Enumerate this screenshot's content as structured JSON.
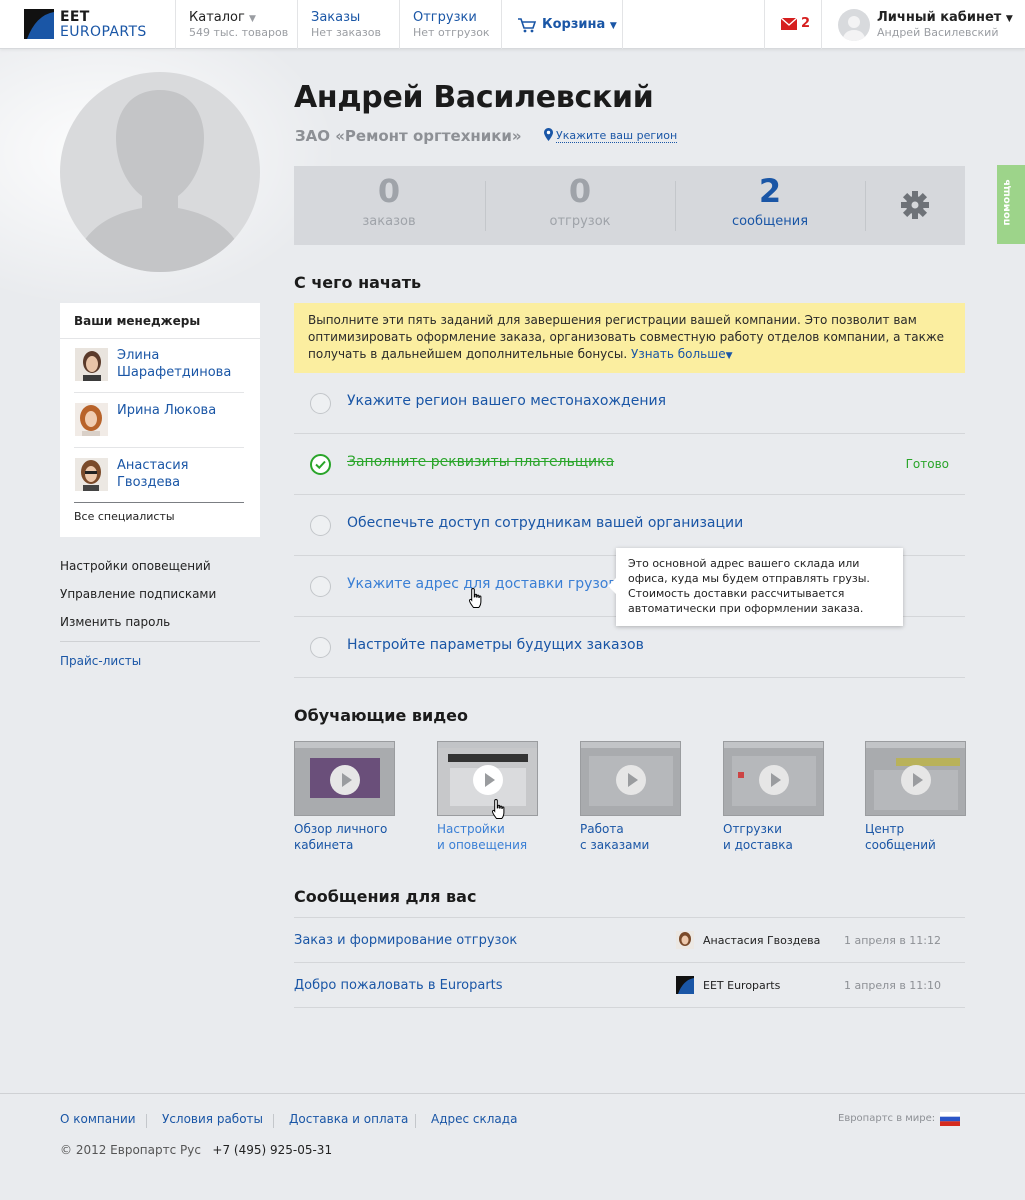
{
  "header": {
    "logo_top": "EET",
    "logo_bottom": "EUROPARTS",
    "nav": [
      {
        "label": "Каталог",
        "sub": "549 тыс. товаров"
      },
      {
        "label": "Заказы",
        "sub": "Нет заказов"
      },
      {
        "label": "Отгрузки",
        "sub": "Нет отгрузок"
      }
    ],
    "cart_label": "Корзина",
    "mail_count": "2",
    "account_label": "Личный кабинет",
    "account_user": "Андрей Василевский"
  },
  "profile": {
    "name": "Андрей Василевский",
    "company": "ЗАО «Ремонт оргтехники»",
    "region_link": "Укажите ваш регион"
  },
  "stats": [
    {
      "value": "0",
      "caption": "заказов"
    },
    {
      "value": "0",
      "caption": "отгрузок"
    },
    {
      "value": "2",
      "caption": "сообщения"
    }
  ],
  "help_label": "помощь",
  "managers": {
    "title": "Ваши менеджеры",
    "items": [
      {
        "name": "Элина Шарафетдинова"
      },
      {
        "name": "Ирина Люкова"
      },
      {
        "name": "Анастасия Гвоздева"
      }
    ],
    "all_link": "Все специалисты"
  },
  "left_menu": [
    "Настройки оповещений",
    "Управление подписками",
    "Изменить пароль"
  ],
  "price_lists": "Прайс-листы",
  "start": {
    "title": "С чего начать",
    "note": "Выполните эти пять заданий для завершения регистрации вашей компании. Это позволит вам оптимизировать оформление заказа, организовать совместную работу отделов компании, а также получать в дальнейшем дополнительные бонусы.",
    "more_link": "Узнать больше",
    "tasks": [
      {
        "label": "Укажите регион вашего местонахождения",
        "done": false
      },
      {
        "label": "Заполните реквизиты плательщика",
        "done": true,
        "status": "Готово"
      },
      {
        "label": "Обеспечьте доступ сотрудникам вашей организации",
        "done": false
      },
      {
        "label": "Укажите адрес для доставки грузов",
        "done": false
      },
      {
        "label": "Настройте параметры будущих заказов",
        "done": false
      }
    ],
    "tooltip": "Это основной адрес вашего склада или офиса, куда мы будем отправлять грузы. Стоимость доставки рассчитывается автоматически при оформлении заказа."
  },
  "videos": {
    "title": "Обучающие видео",
    "items": [
      {
        "line1": "Обзор личного",
        "line2": "кабинета"
      },
      {
        "line1": "Настройки",
        "line2": "и оповещения"
      },
      {
        "line1": "Работа",
        "line2": "с заказами"
      },
      {
        "line1": "Отгрузки",
        "line2": "и доставка"
      },
      {
        "line1": "Центр",
        "line2": "сообщений"
      }
    ]
  },
  "messages": {
    "title": "Сообщения для вас",
    "items": [
      {
        "subject": "Заказ и формирование отгрузок",
        "from": "Анастасия Гвоздева",
        "date": "1 апреля в 11:12"
      },
      {
        "subject": "Добро пожаловать в Europarts",
        "from": "EET Europarts",
        "date": "1 апреля в 11:10"
      }
    ]
  },
  "footer": {
    "links": [
      "О компании",
      "Условия работы",
      "Доставка и оплата",
      "Адрес склада"
    ],
    "world_label": "Европартс в мире:",
    "copyright": "© 2012 Европартс Рус",
    "phone": "+7 (495) 925-05-31"
  }
}
